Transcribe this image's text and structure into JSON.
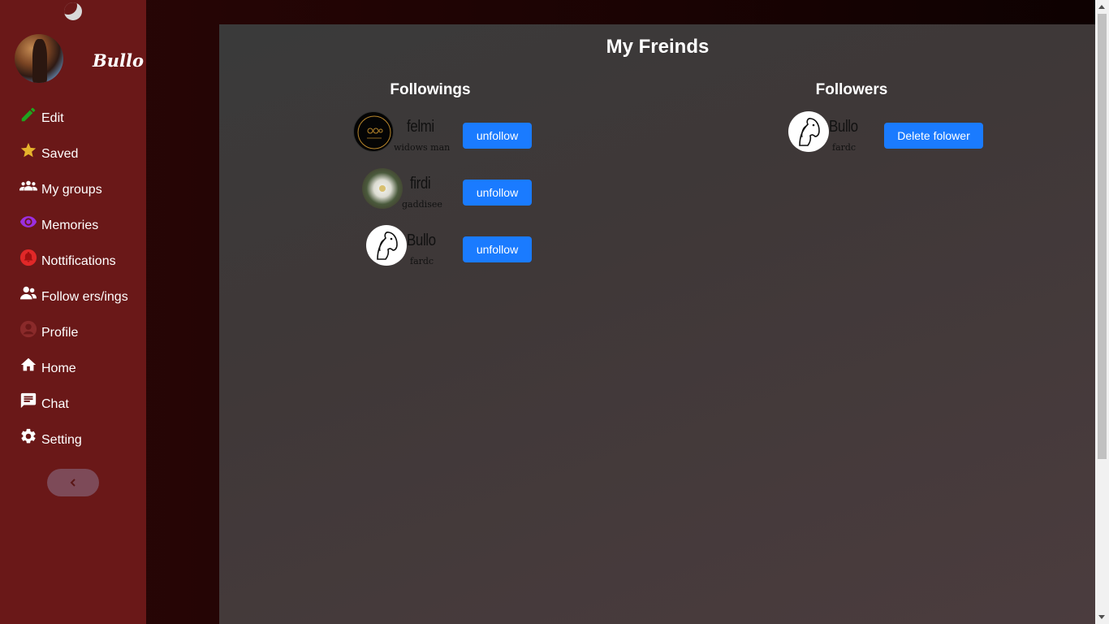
{
  "sidebar": {
    "brand": "Bullo",
    "items": [
      {
        "label": "Edit",
        "icon": "pencil-icon",
        "color": "#1fa51f"
      },
      {
        "label": "Saved",
        "icon": "star-icon",
        "color": "#e6b32c"
      },
      {
        "label": "My groups",
        "icon": "groups-icon",
        "color": "#ffffff"
      },
      {
        "label": "Memories",
        "icon": "eye-icon",
        "color": "#9b2fe0"
      },
      {
        "label": "Nottifications",
        "icon": "bell-icon",
        "color": "#e02828"
      },
      {
        "label": "Follow ers/ings",
        "icon": "people-icon",
        "color": "#ffffff"
      },
      {
        "label": "Profile",
        "icon": "user-circle-icon",
        "color": "#8a2a2a"
      },
      {
        "label": "Home",
        "icon": "home-icon",
        "color": "#ffffff"
      },
      {
        "label": "Chat",
        "icon": "chat-icon",
        "color": "#ffffff"
      },
      {
        "label": "Setting",
        "icon": "gear-icon",
        "color": "#ffffff"
      }
    ]
  },
  "main": {
    "title": "My Freinds",
    "followings": {
      "heading": "Followings",
      "users": [
        {
          "name": "felmi",
          "subtitle": "widows man",
          "button": "unfollow"
        },
        {
          "name": "firdi",
          "subtitle": "gaddisee",
          "button": "unfollow"
        },
        {
          "name": "Bullo",
          "subtitle": "fardc",
          "button": "unfollow"
        }
      ]
    },
    "followers": {
      "heading": "Followers",
      "users": [
        {
          "name": "Bullo",
          "subtitle": "fardc",
          "button": "Delete folower"
        }
      ]
    }
  },
  "colors": {
    "sidebar_bg": "#6a1818",
    "accent_button": "#1a7bff",
    "panel_bg": "#3f3838"
  }
}
